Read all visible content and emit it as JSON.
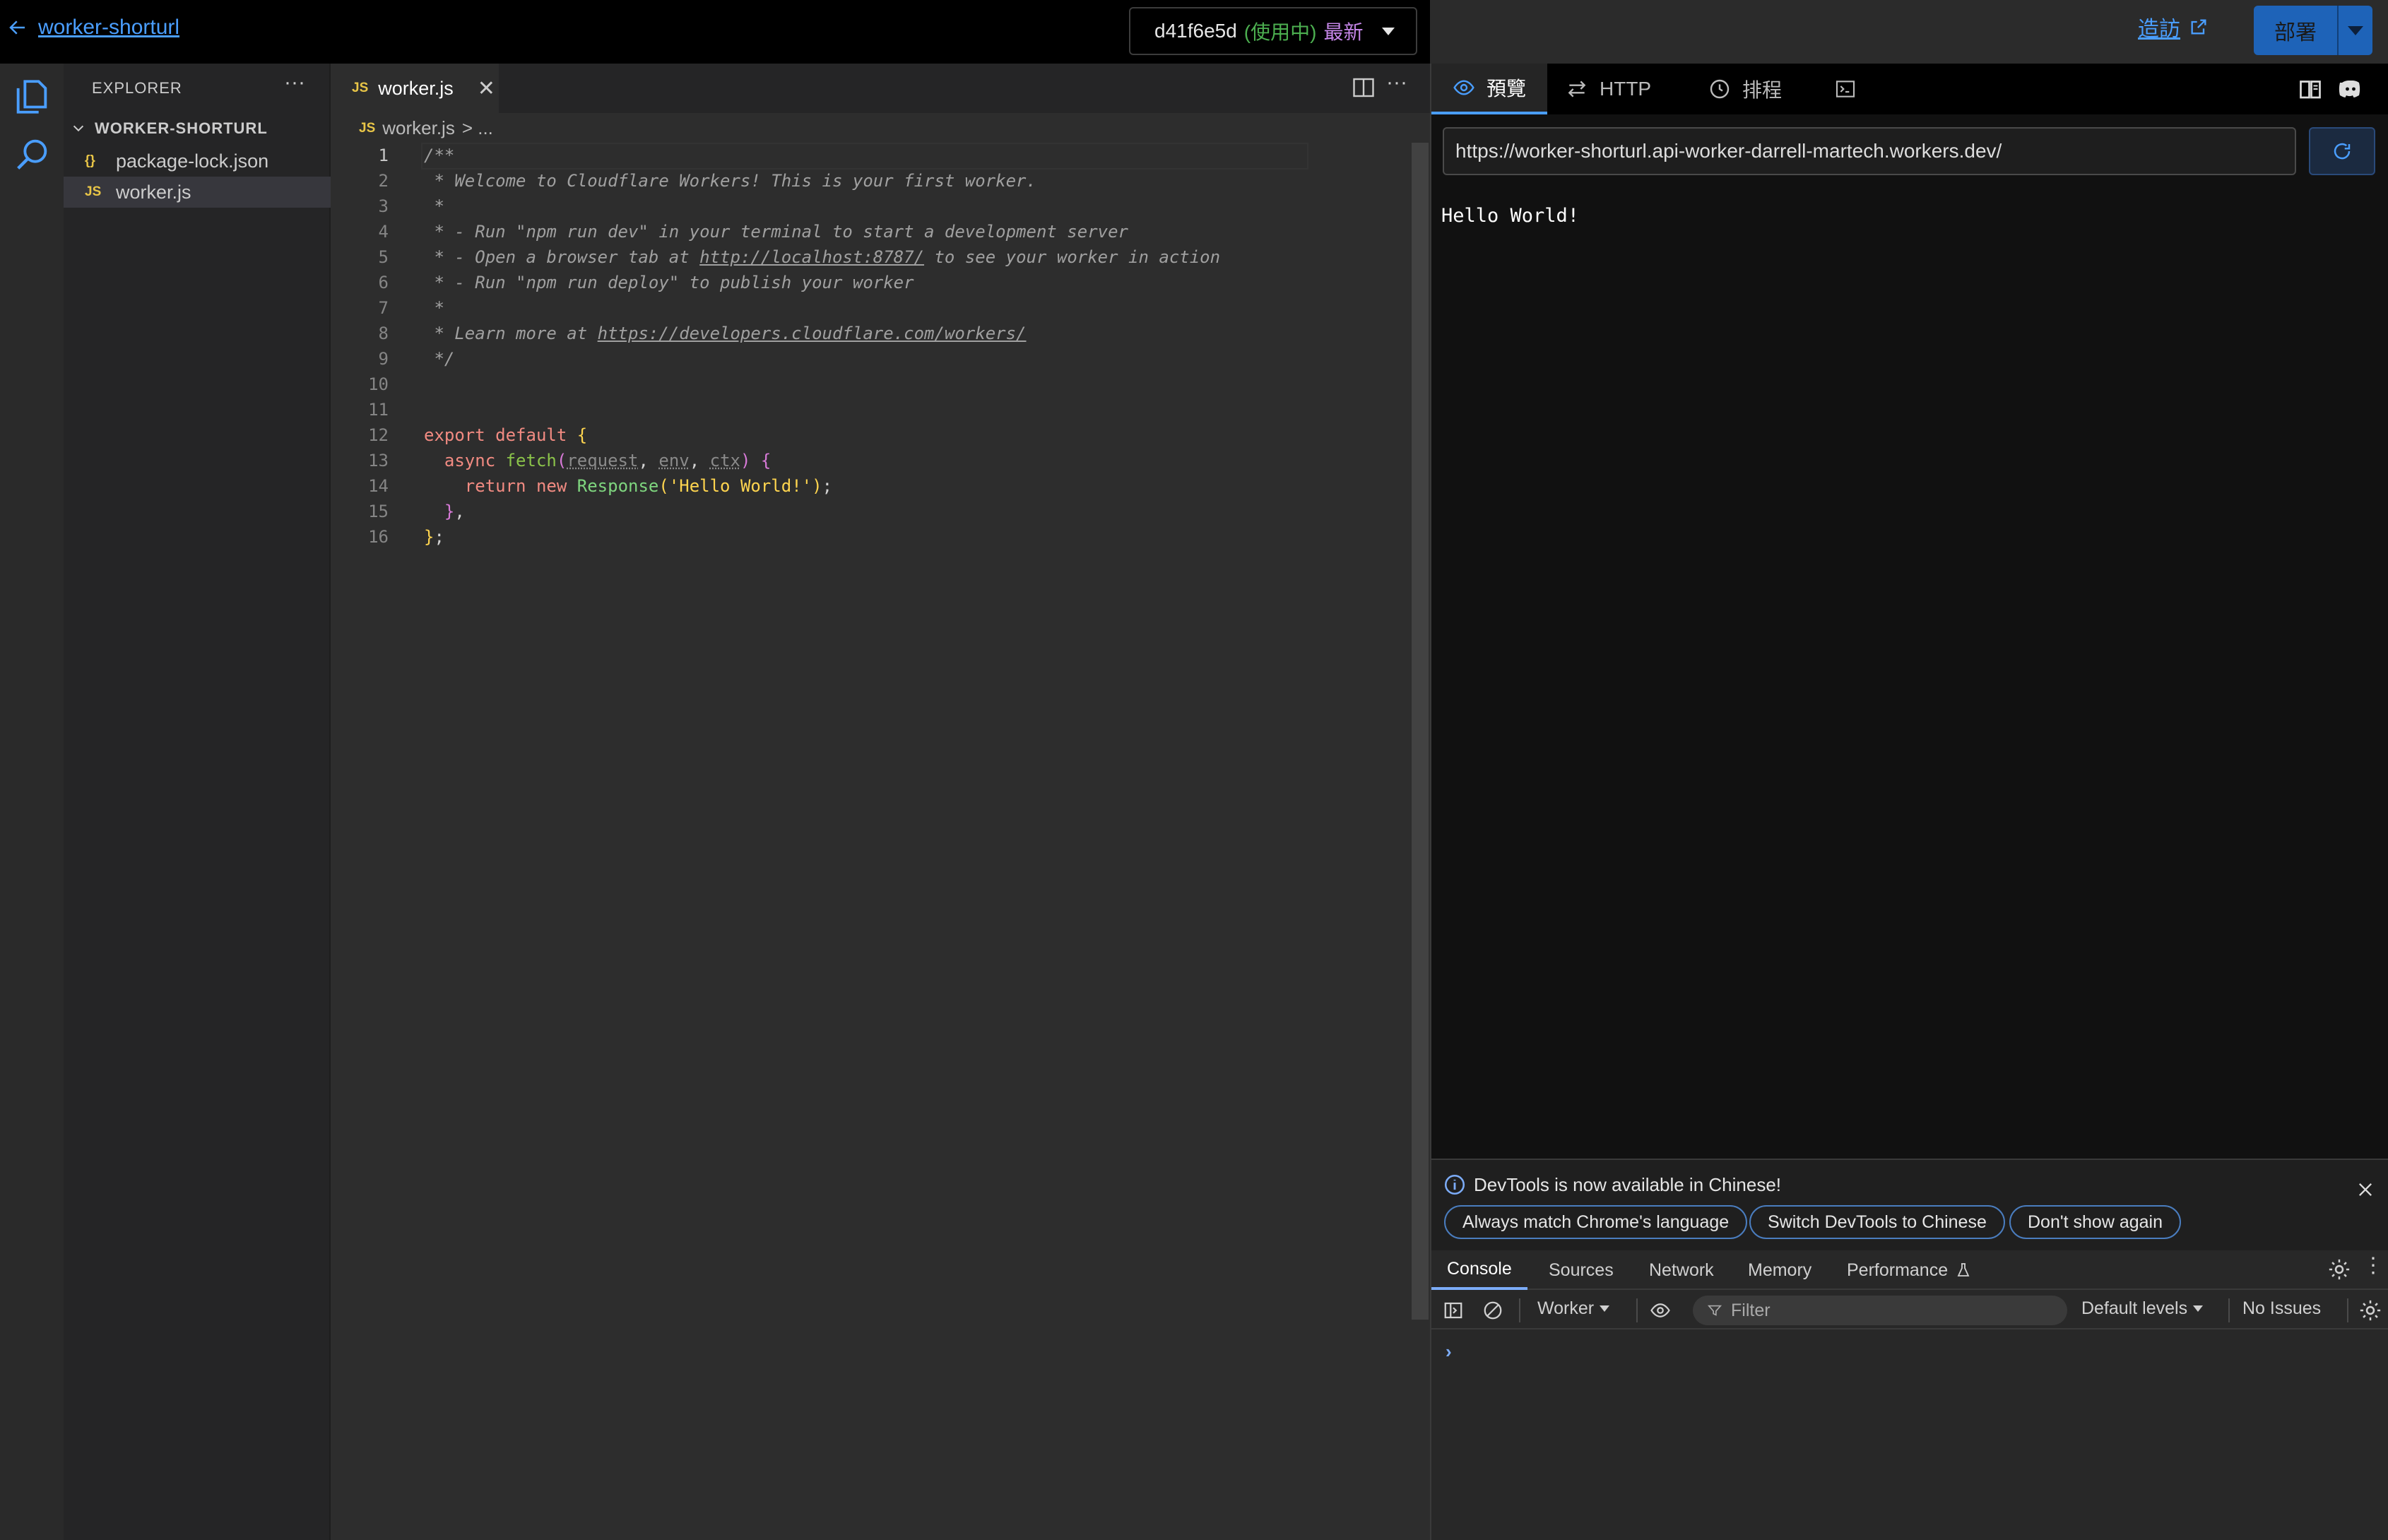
{
  "topbar": {
    "back_label": "worker-shorturl",
    "version_hash": "d41f6e5d",
    "version_status": "(使用中)",
    "version_latest": "最新",
    "visit_label": "造訪",
    "deploy_label": "部署"
  },
  "explorer": {
    "title": "EXPLORER",
    "more": "···",
    "folder": "WORKER-SHORTURL",
    "files": [
      {
        "badge": "{}",
        "name": "package-lock.json"
      },
      {
        "badge": "JS",
        "name": "worker.js"
      }
    ]
  },
  "editor": {
    "tab_badge": "JS",
    "tab_label": "worker.js",
    "tab_close": "✕",
    "more": "···",
    "breadcrumb_badge": "JS",
    "breadcrumb_file": "worker.js",
    "breadcrumb_rest": "> ...",
    "line_numbers": [
      "1",
      "2",
      "3",
      "4",
      "5",
      "6",
      "7",
      "8",
      "9",
      "10",
      "11",
      "12",
      "13",
      "14",
      "15",
      "16"
    ],
    "comment": {
      "l1": "/**",
      "l2": " * Welcome to Cloudflare Workers! This is your first worker.",
      "l3": " *",
      "l4": " * - Run \"npm run dev\" in your terminal to start a development server",
      "l5_a": " * - Open a browser tab at ",
      "l5_link": "http://localhost:8787/",
      "l5_b": " to see your worker in action",
      "l6": " * - Run \"npm run deploy\" to publish your worker",
      "l7": " *",
      "l8_a": " * Learn more at ",
      "l8_link": "https://developers.cloudflare.com/workers/",
      "l9": " */"
    },
    "code": {
      "export": "export",
      "default": "default",
      "async": "async",
      "fetch": "fetch",
      "p_request": "request",
      "p_env": "env",
      "p_ctx": "ctx",
      "return": "return",
      "new": "new",
      "response": "Response",
      "hello_str": "'Hello World!'"
    }
  },
  "preview": {
    "tabs": [
      {
        "icon": "eye-icon",
        "label": "預覽"
      },
      {
        "icon": "arrows-icon",
        "label": "HTTP"
      },
      {
        "icon": "clock-icon",
        "label": "排程"
      },
      {
        "icon": "terminal-icon",
        "label": ""
      }
    ],
    "url": "https://worker-shorturl.api-worker-darrell-martech.workers.dev/",
    "output": "Hello World!"
  },
  "devtools": {
    "info_text": "DevTools is now available in Chinese!",
    "buttons": [
      "Always match Chrome's language",
      "Switch DevTools to Chinese",
      "Don't show again"
    ],
    "tabs": [
      "Console",
      "Sources",
      "Network",
      "Memory",
      "Performance"
    ],
    "worker_select": "Worker",
    "filter_placeholder": "Filter",
    "levels": "Default levels",
    "issues": "No Issues",
    "prompt": "›"
  },
  "colors": {
    "accent": "#4a9eff",
    "deploy_bg": "#1e63b8",
    "active_status": "#4caf50",
    "latest": "#c586e8"
  }
}
